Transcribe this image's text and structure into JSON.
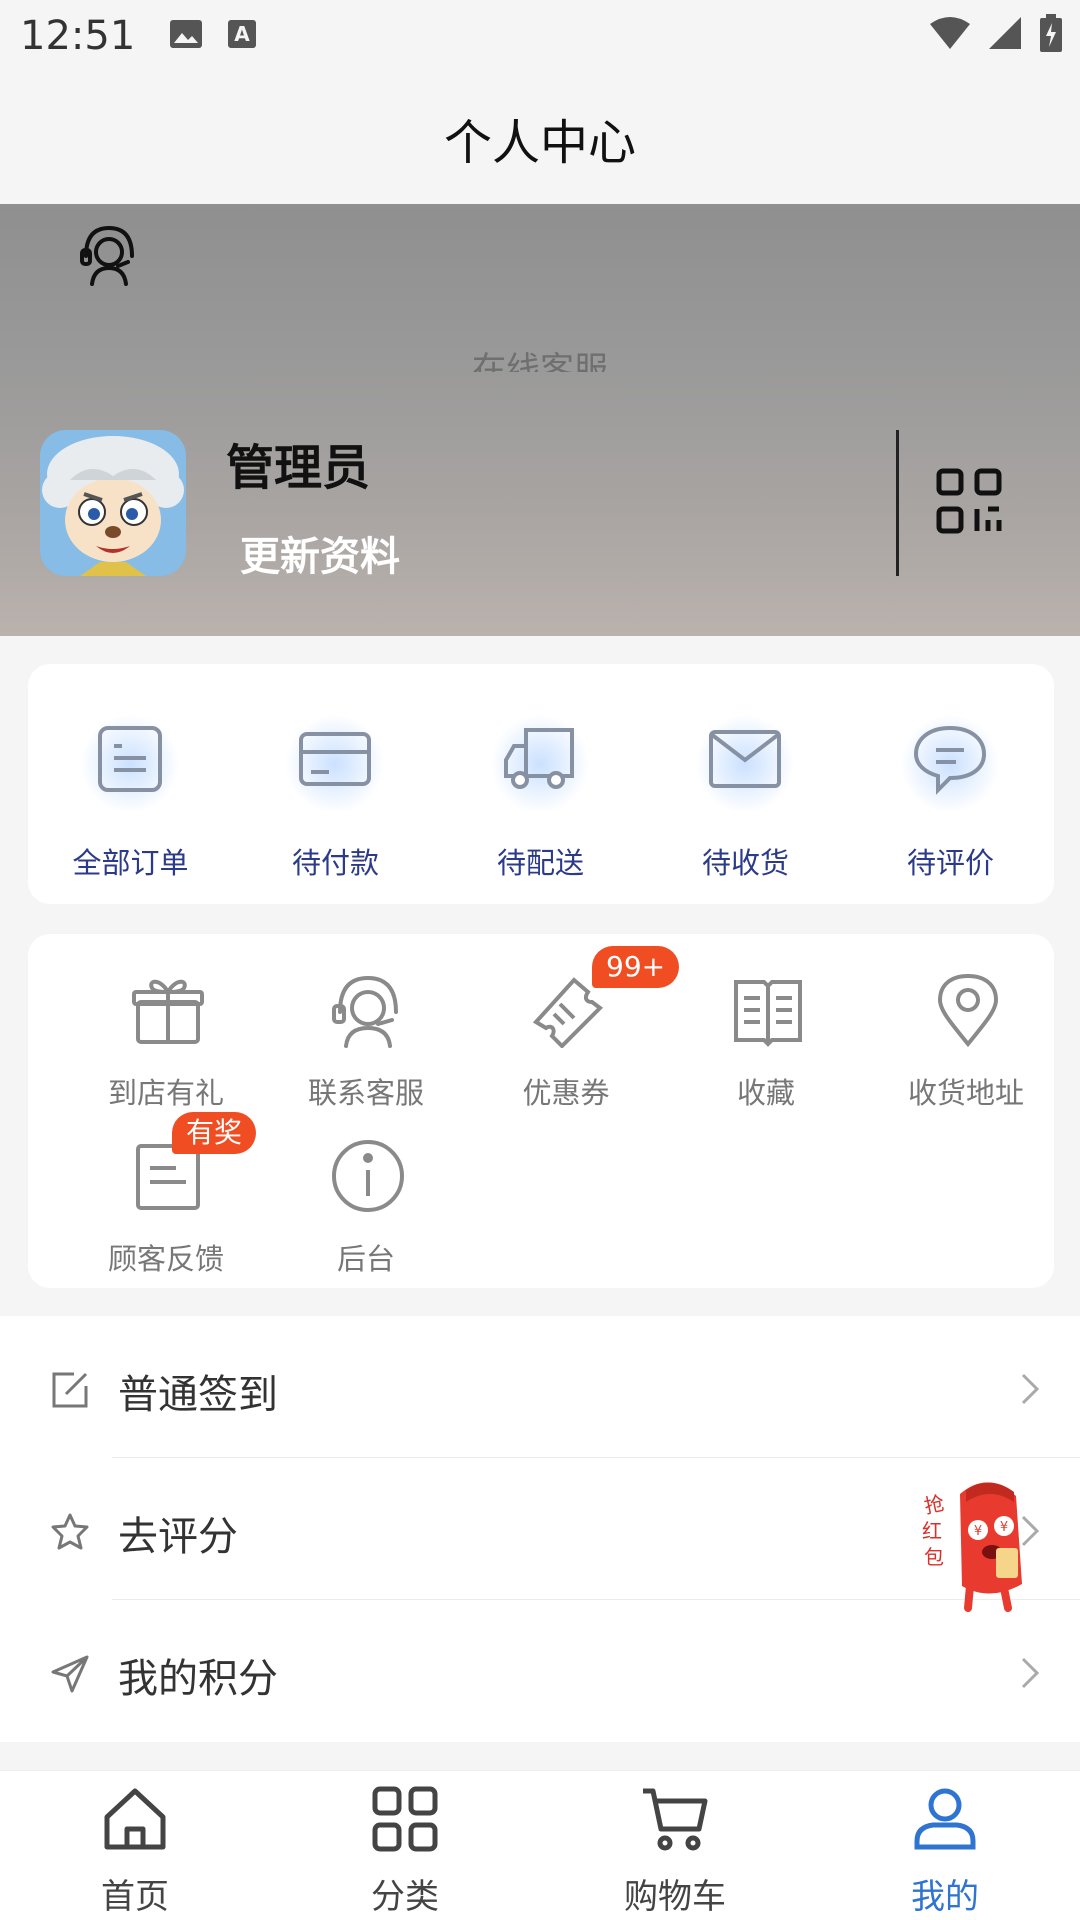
{
  "status_bar": {
    "time": "12:51",
    "icons": [
      "image-icon",
      "font-icon",
      "wifi-icon",
      "signal-icon",
      "battery-charging-icon"
    ]
  },
  "header": {
    "title": "个人中心"
  },
  "profile": {
    "customer_service_label": "在线客服",
    "username": "管理员",
    "update_link": "更新资料",
    "qr_icon": "qr-code-icon"
  },
  "orders": [
    {
      "label": "全部订单",
      "icon": "all-orders-icon"
    },
    {
      "label": "待付款",
      "icon": "card-icon"
    },
    {
      "label": "待配送",
      "icon": "truck-icon"
    },
    {
      "label": "待收货",
      "icon": "envelope-icon"
    },
    {
      "label": "待评价",
      "icon": "chat-icon"
    }
  ],
  "services": [
    {
      "label": "到店有礼",
      "icon": "gift-icon"
    },
    {
      "label": "联系客服",
      "icon": "headset-icon"
    },
    {
      "label": "优惠券",
      "icon": "coupon-icon",
      "badge": "99+"
    },
    {
      "label": "收藏",
      "icon": "book-icon"
    },
    {
      "label": "收货地址",
      "icon": "location-icon"
    },
    {
      "label": "顾客反馈",
      "icon": "feedback-icon",
      "badge": "有奖"
    },
    {
      "label": "后台",
      "icon": "info-icon"
    }
  ],
  "menu": [
    {
      "label": "普通签到",
      "icon": "edit-icon"
    },
    {
      "label": "去评分",
      "icon": "star-icon"
    },
    {
      "label": "我的积分",
      "icon": "send-icon"
    }
  ],
  "tabs": [
    {
      "label": "首页",
      "icon": "home-icon"
    },
    {
      "label": "分类",
      "icon": "grid-icon"
    },
    {
      "label": "购物车",
      "icon": "cart-icon"
    },
    {
      "label": "我的",
      "icon": "user-icon",
      "active": true
    }
  ],
  "colors": {
    "accent": "#2f74d0",
    "order_label": "#2c3a8a",
    "badge": "#f04e22"
  }
}
